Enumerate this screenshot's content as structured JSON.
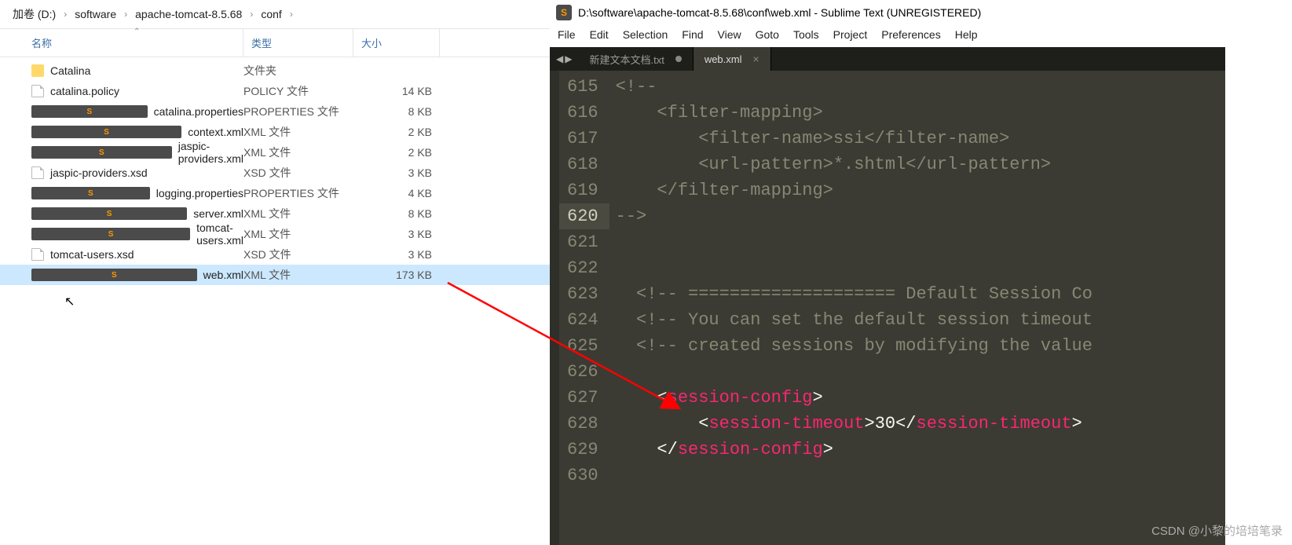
{
  "explorer": {
    "breadcrumb": [
      "加卷 (D:)",
      "software",
      "apache-tomcat-8.5.68",
      "conf"
    ],
    "columns": {
      "name": "名称",
      "type": "类型",
      "size": "大小"
    },
    "files": [
      {
        "name": "Catalina",
        "type": "文件夹",
        "size": "",
        "icon": "folder"
      },
      {
        "name": "catalina.policy",
        "type": "POLICY 文件",
        "size": "14 KB",
        "icon": "generic"
      },
      {
        "name": "catalina.properties",
        "type": "PROPERTIES 文件",
        "size": "8 KB",
        "icon": "sublime"
      },
      {
        "name": "context.xml",
        "type": "XML 文件",
        "size": "2 KB",
        "icon": "sublime"
      },
      {
        "name": "jaspic-providers.xml",
        "type": "XML 文件",
        "size": "2 KB",
        "icon": "sublime"
      },
      {
        "name": "jaspic-providers.xsd",
        "type": "XSD 文件",
        "size": "3 KB",
        "icon": "generic"
      },
      {
        "name": "logging.properties",
        "type": "PROPERTIES 文件",
        "size": "4 KB",
        "icon": "sublime"
      },
      {
        "name": "server.xml",
        "type": "XML 文件",
        "size": "8 KB",
        "icon": "sublime"
      },
      {
        "name": "tomcat-users.xml",
        "type": "XML 文件",
        "size": "3 KB",
        "icon": "sublime"
      },
      {
        "name": "tomcat-users.xsd",
        "type": "XSD 文件",
        "size": "3 KB",
        "icon": "generic"
      },
      {
        "name": "web.xml",
        "type": "XML 文件",
        "size": "173 KB",
        "icon": "sublime",
        "selected": true
      }
    ]
  },
  "sublime": {
    "title": "D:\\software\\apache-tomcat-8.5.68\\conf\\web.xml - Sublime Text (UNREGISTERED)",
    "menu": [
      "File",
      "Edit",
      "Selection",
      "Find",
      "View",
      "Goto",
      "Tools",
      "Project",
      "Preferences",
      "Help"
    ],
    "tabs": [
      {
        "label": "新建文本文档.txt",
        "active": false,
        "dirty": true
      },
      {
        "label": "web.xml",
        "active": true,
        "dirty": false
      }
    ],
    "first_line": 615,
    "highlight_line": 620,
    "code_lines": [
      [
        [
          "c-comment",
          "<!--"
        ]
      ],
      [
        [
          "c-comment",
          "    <filter-mapping>"
        ]
      ],
      [
        [
          "c-comment",
          "        <filter-name>ssi</filter-name>"
        ]
      ],
      [
        [
          "c-comment",
          "        <url-pattern>*.shtml</url-pattern>"
        ]
      ],
      [
        [
          "c-comment",
          "    </filter-mapping>"
        ]
      ],
      [
        [
          "c-comment",
          "-->"
        ]
      ],
      [],
      [],
      [
        [
          "c-comment",
          "  <!-- ==================== Default Session Co"
        ]
      ],
      [
        [
          "c-comment",
          "  <!-- You can set the default session timeout"
        ]
      ],
      [
        [
          "c-comment",
          "  <!-- created sessions by modifying the value"
        ]
      ],
      [],
      [
        [
          "c-punct",
          "    <"
        ],
        [
          "c-tag",
          "session-config"
        ],
        [
          "c-punct",
          ">"
        ]
      ],
      [
        [
          "c-punct",
          "        <"
        ],
        [
          "c-tag",
          "session-timeout"
        ],
        [
          "c-punct",
          ">"
        ],
        [
          "c-text",
          "30"
        ],
        [
          "c-punct",
          "</"
        ],
        [
          "c-tag",
          "session-timeout"
        ],
        [
          "c-punct",
          ">"
        ]
      ],
      [
        [
          "c-punct",
          "    </"
        ],
        [
          "c-tag",
          "session-config"
        ],
        [
          "c-punct",
          ">"
        ]
      ],
      []
    ]
  },
  "watermark": "CSDN @小黎的培培笔录"
}
